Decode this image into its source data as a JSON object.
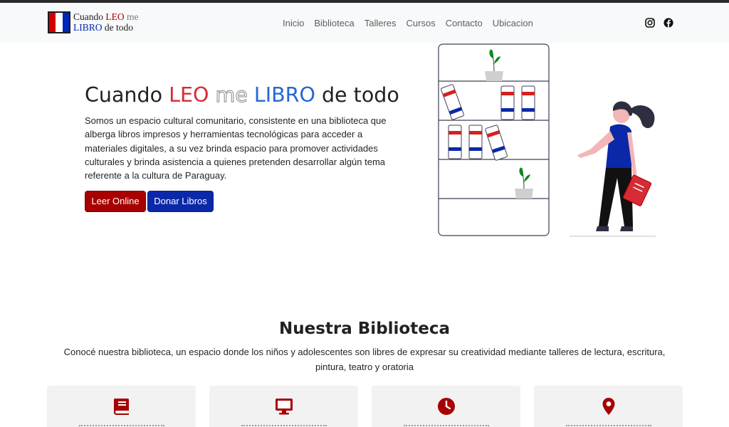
{
  "nav": {
    "brand": {
      "line1a": "Cuando ",
      "line1b": "LEO",
      "line1c": " me",
      "line2a": "LIBRO",
      "line2b": " de todo"
    },
    "links": [
      "Inicio",
      "Biblioteca",
      "Talleres",
      "Cursos",
      "Contacto",
      "Ubicacion"
    ],
    "social": [
      "instagram-icon",
      "facebook-icon"
    ]
  },
  "hero": {
    "title_part1": "Cuando ",
    "title_leo": "LEO",
    "title_me": "me",
    "title_libro": "LIBRO",
    "title_part2": " de todo",
    "description": "Somos un espacio cultural comunitario, consistente en una biblioteca que alberga libros impresos y herramientas tecnológicas para acceder a materiales digitales, a su vez brinda espacio para promover actividades culturales y brinda asistencia a quienes pretenden desarrollar algún tema referente a la cultura de Paraguay.",
    "btn_read": "Leer Online",
    "btn_donate": "Donar Libros"
  },
  "biblioteca": {
    "title": "Nuestra Biblioteca",
    "description": "Conocé nuestra biblioteca, un espacio donde los niños y adolescentes son libres de expresar su creatividad mediante talleres de lectura, escritura, pintura, teatro y oratoria",
    "cards": [
      {
        "icon": "book-icon"
      },
      {
        "icon": "monitor-icon"
      },
      {
        "icon": "clock-icon"
      },
      {
        "icon": "location-pin-icon"
      }
    ]
  },
  "colors": {
    "red": "#a80000",
    "blue": "#0b28a8",
    "brand_red": "#d62b35",
    "brand_blue": "#2566d8"
  }
}
